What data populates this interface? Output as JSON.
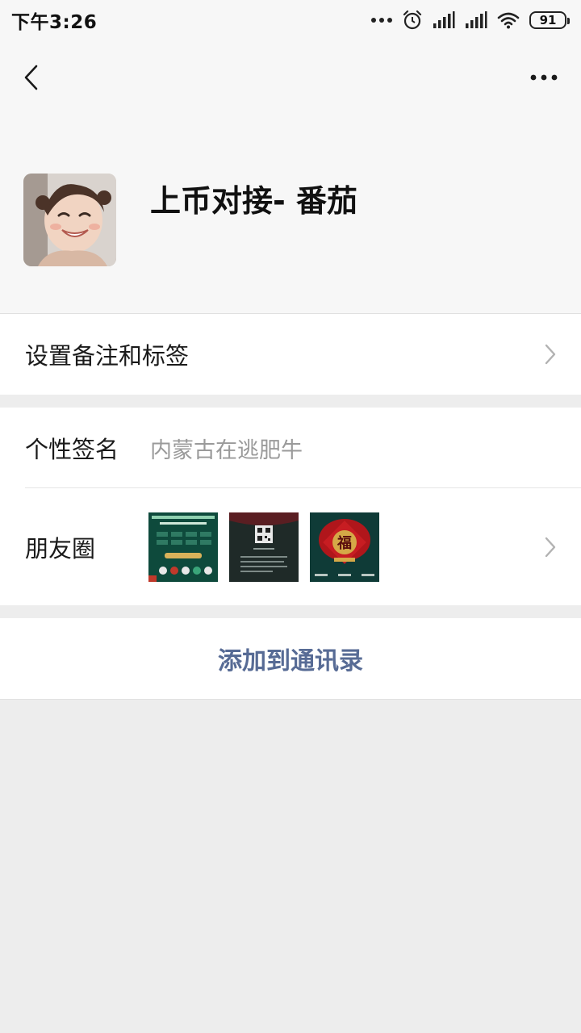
{
  "status_bar": {
    "time": "下午3:26",
    "battery": "91",
    "icons": [
      "more-dots-icon",
      "alarm-icon",
      "signal-icon",
      "signal-icon",
      "wifi-icon",
      "battery-icon"
    ]
  },
  "nav": {
    "back_icon": "chevron-left-icon",
    "more_icon": "more-horizontal-icon"
  },
  "profile": {
    "name": "上币对接- 番茄",
    "avatar": "avatar-photo"
  },
  "rows": {
    "remark_label": "设置备注和标签",
    "signature_label": "个性签名",
    "signature_value": "内蒙古在逃肥牛",
    "moments_label": "朋友圈"
  },
  "actions": {
    "add_contact": "添加到通讯录"
  },
  "colors": {
    "background": "#ededed",
    "link_blue": "#576b95",
    "secondary_text": "#9a9a9a"
  }
}
